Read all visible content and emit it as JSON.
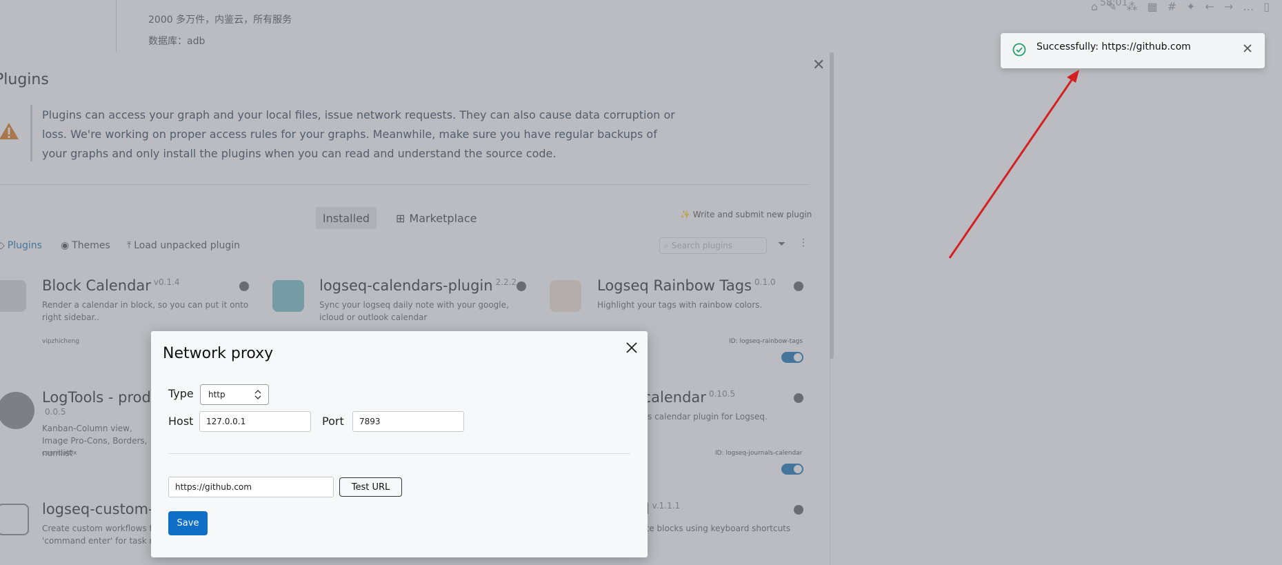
{
  "background": {
    "top_line1": "2000 多万件，内鉴云，所有服务",
    "top_line2": "数据库：adb",
    "top_time": "58:01",
    "plugins_panel": {
      "title": "Plugins",
      "warning": "Plugins can access your graph and your local files, issue network requests. They can also cause data corruption or loss. We're working on proper access rules for your graphs. Meanwhile, make sure you have regular backups of your graphs and only install the plugins when you can read and understand the source code.",
      "tabs": {
        "installed": "Installed",
        "marketplace": "Marketplace"
      },
      "write_link": "✨ Write and submit new plugin",
      "subtabs": {
        "plugins": "Plugins",
        "themes": "Themes",
        "load_unpacked": "Load unpacked plugin"
      },
      "search_placeholder": "Search plugins",
      "cards": [
        {
          "name": "Block Calendar",
          "version": "v0.1.4",
          "desc": "Render a calendar in block, so you can put it onto right sidebar..",
          "author": "vipzhicheng",
          "id": ""
        },
        {
          "name": "logseq-calendars-plugin",
          "version": "2.2.2",
          "desc": "Sync your logseq daily note with your google, icloud or outlook calendar",
          "author": "",
          "id": ""
        },
        {
          "name": "Logseq Rainbow Tags",
          "version": "0.1.0",
          "desc": "Highlight your tags with rainbow colors.",
          "author": "",
          "id": "ID: logseq-rainbow-tags"
        },
        {
          "name": "LogTools - produ",
          "version": "0.0.5",
          "desc": "Kanban-Column view, Image Pro-Cons, Borders, numlist",
          "author": "cannibalOx",
          "id": ""
        },
        {
          "name": "s calendar",
          "version": "0.10.5",
          "desc": "rnals calendar plugin for Logseq.",
          "author": "",
          "id": "ID: logseq-journals-calendar"
        },
        {
          "name": "logseq-custom-w",
          "version": "",
          "desc": "Create custom workflows fo 'command enter' for task m",
          "author": "",
          "id": ""
        },
        {
          "name": "dd",
          "version": "v.1.1.1",
          "desc": "licate blocks using keyboard shortcuts",
          "author": "",
          "id": ""
        }
      ]
    }
  },
  "modal": {
    "title": "Network proxy",
    "type_label": "Type",
    "type_value": "http",
    "host_label": "Host",
    "host_value": "127.0.0.1",
    "port_label": "Port",
    "port_value": "7893",
    "test_url_value": "https://github.com",
    "test_button": "Test URL",
    "save_button": "Save"
  },
  "toast": {
    "message": "Successfully: https://github.com",
    "status_color": "#22a06b"
  },
  "colors": {
    "primary": "#0f6fc6",
    "annotation_arrow": "#d42020"
  }
}
